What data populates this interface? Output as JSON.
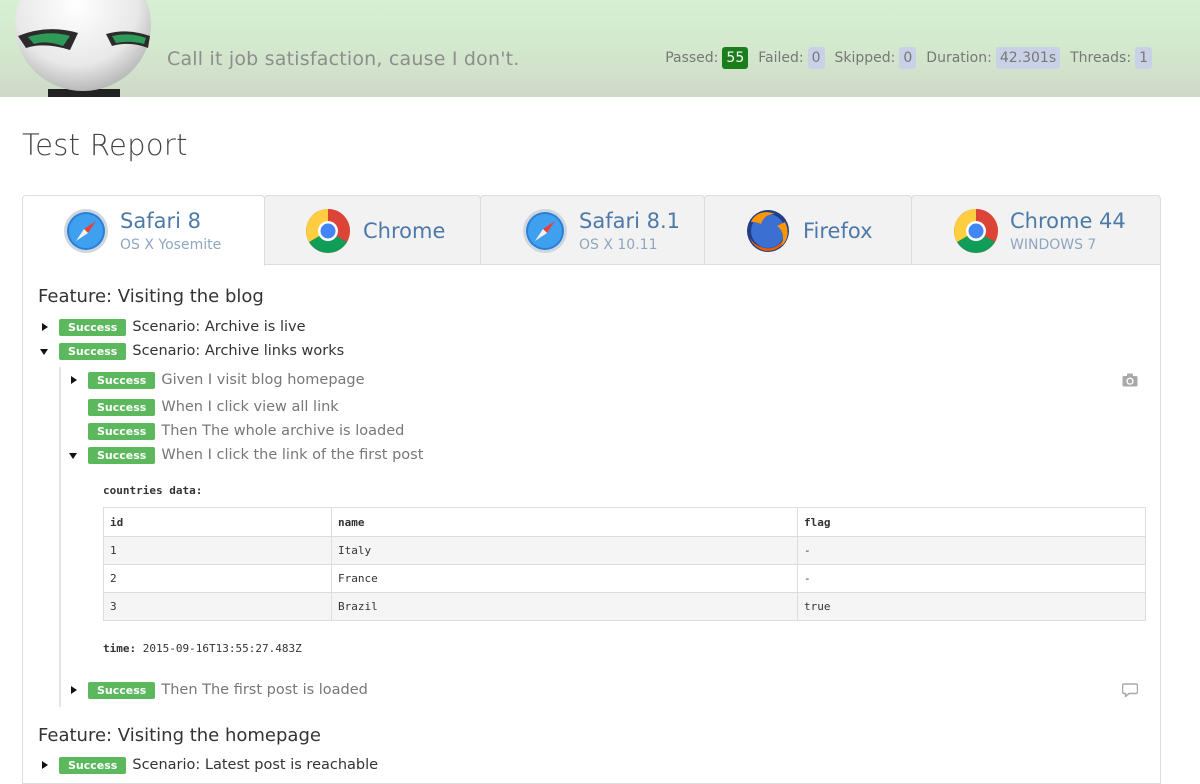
{
  "header": {
    "tagline": "Call it job satisfaction, cause I don't.",
    "stats": [
      {
        "label": "Passed:",
        "value": "55",
        "kind": "passed"
      },
      {
        "label": "Failed:",
        "value": "0",
        "kind": "neutral"
      },
      {
        "label": "Skipped:",
        "value": "0",
        "kind": "neutral"
      },
      {
        "label": "Duration:",
        "value": "42.301s",
        "kind": "neutral"
      },
      {
        "label": "Threads:",
        "value": "1",
        "kind": "neutral"
      }
    ]
  },
  "page_title": "Test Report",
  "tabs": [
    {
      "name": "Safari 8",
      "sub": "OS X Yosemite",
      "icon": "safari-icon",
      "active": true
    },
    {
      "name": "Chrome",
      "sub": "",
      "icon": "chrome-icon",
      "active": false
    },
    {
      "name": "Safari 8.1",
      "sub": "OS X 10.11",
      "icon": "safari-icon",
      "active": false
    },
    {
      "name": "Firefox",
      "sub": "",
      "icon": "firefox-icon",
      "active": false
    },
    {
      "name": "Chrome 44",
      "sub": "WINDOWS 7",
      "icon": "chrome-icon",
      "active": false
    }
  ],
  "features": [
    {
      "title": "Feature: Visiting the blog"
    },
    {
      "title": "Feature: Visiting the homepage"
    }
  ],
  "scenarios": [
    {
      "status": "Success",
      "text": "Scenario: Archive is live",
      "expanded": false
    },
    {
      "status": "Success",
      "text": "Scenario: Archive links works",
      "expanded": true
    },
    {
      "status": "Success",
      "text": "Scenario: Latest post is reachable",
      "expanded": false
    }
  ],
  "steps": [
    {
      "status": "Success",
      "text": "Given I visit blog homepage",
      "caret": "right",
      "attachment": "camera-icon"
    },
    {
      "status": "Success",
      "text": "When I click view all link",
      "caret": "none"
    },
    {
      "status": "Success",
      "text": "Then The whole archive is loaded",
      "caret": "none"
    },
    {
      "status": "Success",
      "text": "When I click the link of the first post",
      "caret": "down"
    },
    {
      "status": "Success",
      "text": "Then The first post is loaded",
      "caret": "right",
      "attachment": "comment-icon"
    }
  ],
  "datatable": {
    "label": "countries data:",
    "headers": [
      "id",
      "name",
      "flag"
    ],
    "rows": [
      [
        "1",
        "Italy",
        "-"
      ],
      [
        "2",
        "France",
        "-"
      ],
      [
        "3",
        "Brazil",
        "true"
      ]
    ]
  },
  "timeline": {
    "label": "time:",
    "value": "2015-09-16T13:55:27.483Z"
  }
}
